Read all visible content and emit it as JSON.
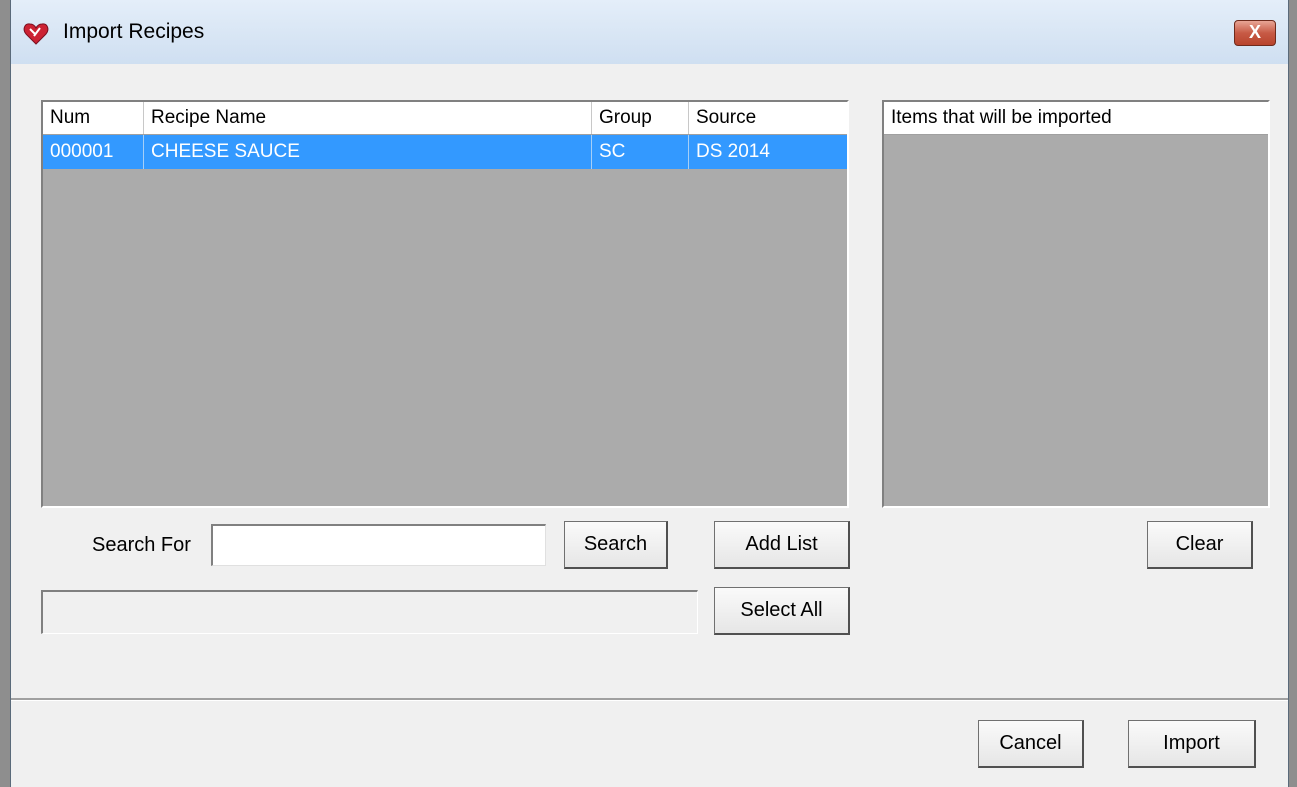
{
  "window": {
    "title": "Import Recipes",
    "close_glyph": "X"
  },
  "recipe_list": {
    "columns": [
      "Num",
      "Recipe Name",
      "Group",
      "Source"
    ],
    "rows": [
      {
        "num": "000001",
        "name": "CHEESE SAUCE",
        "group": "SC",
        "source": "DS 2014",
        "selected": true
      }
    ]
  },
  "import_list": {
    "header": "Items that will be imported"
  },
  "search": {
    "label": "Search For",
    "value": "",
    "search_button": "Search",
    "add_list_button": "Add List",
    "select_all_button": "Select All"
  },
  "clear_button": "Clear",
  "footer": {
    "cancel_button": "Cancel",
    "import_button": "Import"
  },
  "colors": {
    "selection": "#3399ff",
    "list_bg": "#ababab",
    "app_icon": "#cc2233"
  }
}
